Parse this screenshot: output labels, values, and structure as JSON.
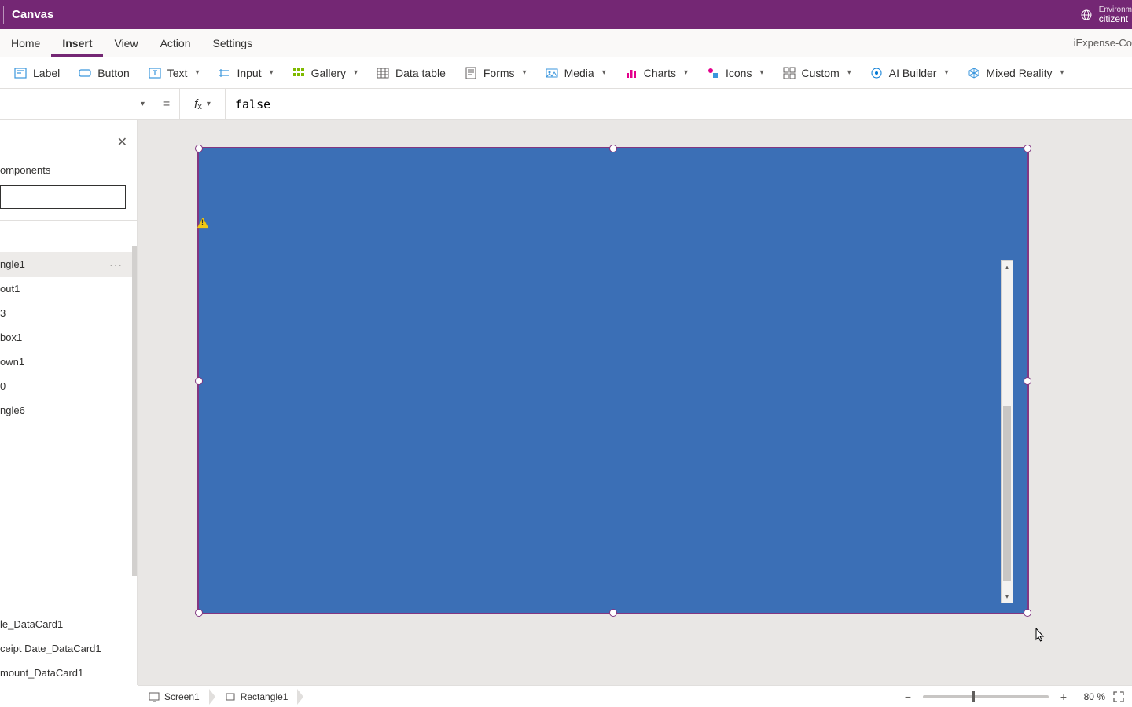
{
  "titlebar": {
    "app_title": "Canvas",
    "environment_label": "Environm",
    "environment_value": "citizent"
  },
  "menubar": {
    "items": [
      "Home",
      "Insert",
      "View",
      "Action",
      "Settings"
    ],
    "active_index": 1,
    "right_text": "iExpense-Co"
  },
  "ribbon": {
    "label": "Label",
    "button": "Button",
    "text": "Text",
    "input": "Input",
    "gallery": "Gallery",
    "data_table": "Data table",
    "forms": "Forms",
    "media": "Media",
    "charts": "Charts",
    "icons": "Icons",
    "custom": "Custom",
    "ai_builder": "AI Builder",
    "mixed_reality": "Mixed Reality"
  },
  "formula": {
    "equals": "=",
    "fx": "fx",
    "value": "false"
  },
  "left_panel": {
    "tab_label": "omponents",
    "tree_items": [
      "ngle1",
      "out1",
      "3",
      "box1",
      "own1",
      "0",
      "ngle6"
    ],
    "selected_index": 0,
    "bottom_items": [
      "le_DataCard1",
      "ceipt Date_DataCard1",
      "mount_DataCard1"
    ]
  },
  "statusbar": {
    "crumb_screen": "Screen1",
    "crumb_rect": "Rectangle1",
    "zoom_value": "80",
    "zoom_pct": "%"
  }
}
